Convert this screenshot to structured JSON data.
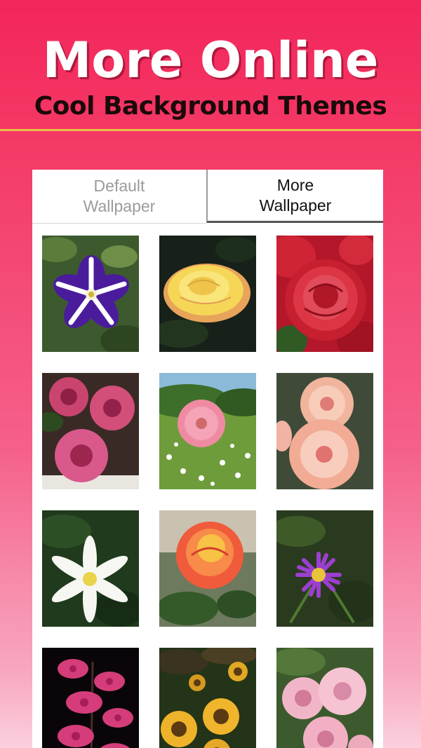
{
  "banner": {
    "title": "More Online",
    "subtitle": "Cool Background Themes"
  },
  "tabs": {
    "default": {
      "line1": "Default",
      "line2": "Wallpaper"
    },
    "more": {
      "line1": "More",
      "line2": "Wallpaper"
    },
    "selected": "more"
  },
  "colors": {
    "banner_top": "#f3255a",
    "background_bottom": "#fbd0de",
    "divider": "#e7c24a",
    "panel": "#ffffff"
  },
  "wallpapers": [
    {
      "id": "w1",
      "icon": "purple-white-petunia-image"
    },
    {
      "id": "w2",
      "icon": "yellow-rose-image"
    },
    {
      "id": "w3",
      "icon": "red-rose-image"
    },
    {
      "id": "w4",
      "icon": "pink-chrysanthemum-image"
    },
    {
      "id": "w5",
      "icon": "pink-gerbera-meadow-image"
    },
    {
      "id": "w6",
      "icon": "peach-dahlia-image"
    },
    {
      "id": "w7",
      "icon": "white-lily-image"
    },
    {
      "id": "w8",
      "icon": "orange-rose-image"
    },
    {
      "id": "w9",
      "icon": "purple-aster-image"
    },
    {
      "id": "w10",
      "icon": "pink-orchid-image"
    },
    {
      "id": "w11",
      "icon": "sunflowers-image"
    },
    {
      "id": "w12",
      "icon": "pink-chrysanthemums-image"
    }
  ]
}
